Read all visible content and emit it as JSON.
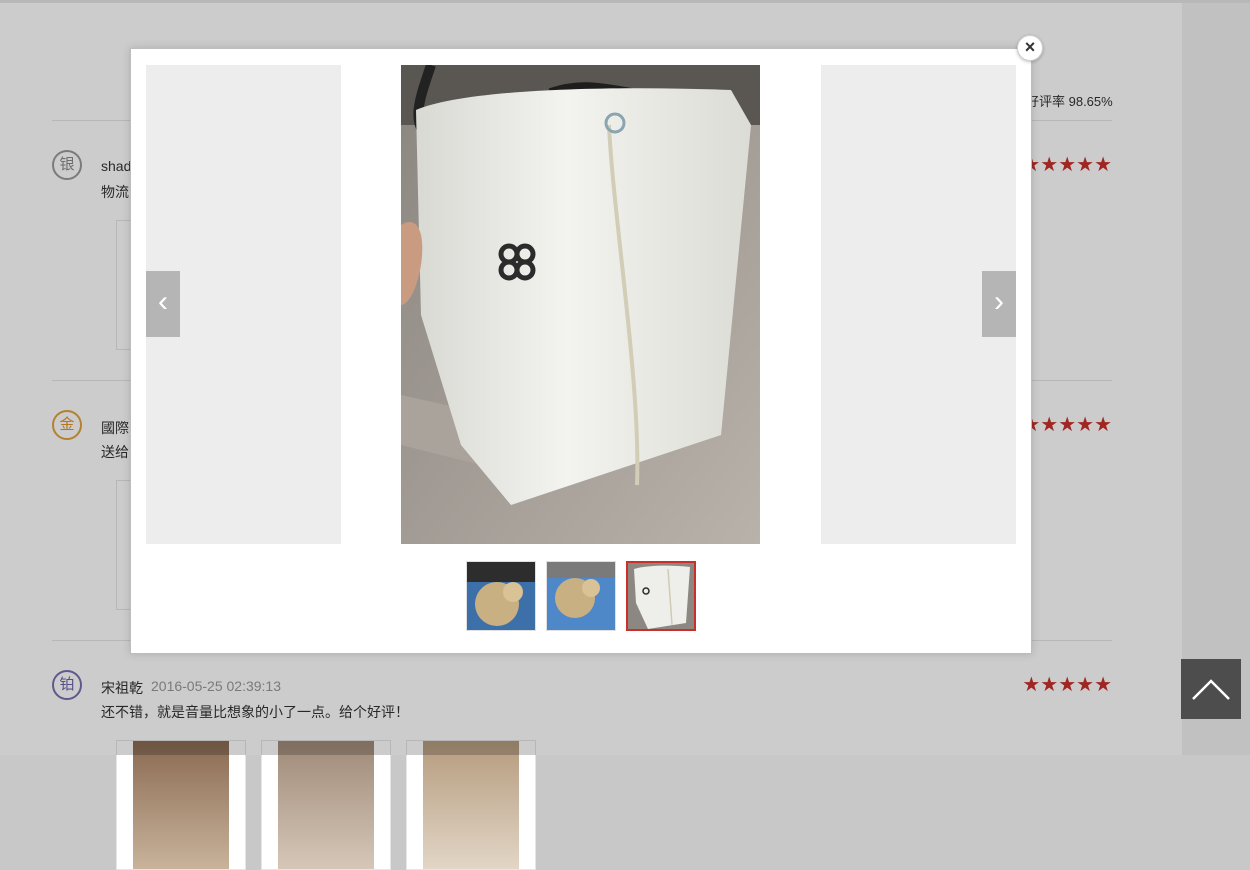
{
  "page": {
    "good_rate_label": "好评率 98.65%",
    "back_to_top_icon": "chevron-up-icon"
  },
  "reviews": [
    {
      "badge": "银",
      "badge_level": "silver",
      "username": "shad",
      "time": "",
      "text": "物流",
      "stars": "★★★★★"
    },
    {
      "badge": "金",
      "badge_level": "gold",
      "username": "國際",
      "time": "",
      "text": "送给",
      "stars": "★★★★★"
    },
    {
      "badge": "铂",
      "badge_level": "platinum",
      "username": "宋祖乾",
      "time": "2016-05-25 02:39:13",
      "text": "还不错，就是音量比想象的小了一点。给个好评！",
      "stars": "★★★★★"
    }
  ],
  "viewer": {
    "close_label": "×",
    "prev_label": "‹",
    "next_label": "›",
    "selected_index": 3,
    "thumbnail_count": 3
  },
  "colors": {
    "star": "#c9302c",
    "active_thumb_border": "#c9302c",
    "overlay": "rgba(0,0,0,0.2)",
    "back_to_top_bg": "#4d4d4d"
  }
}
